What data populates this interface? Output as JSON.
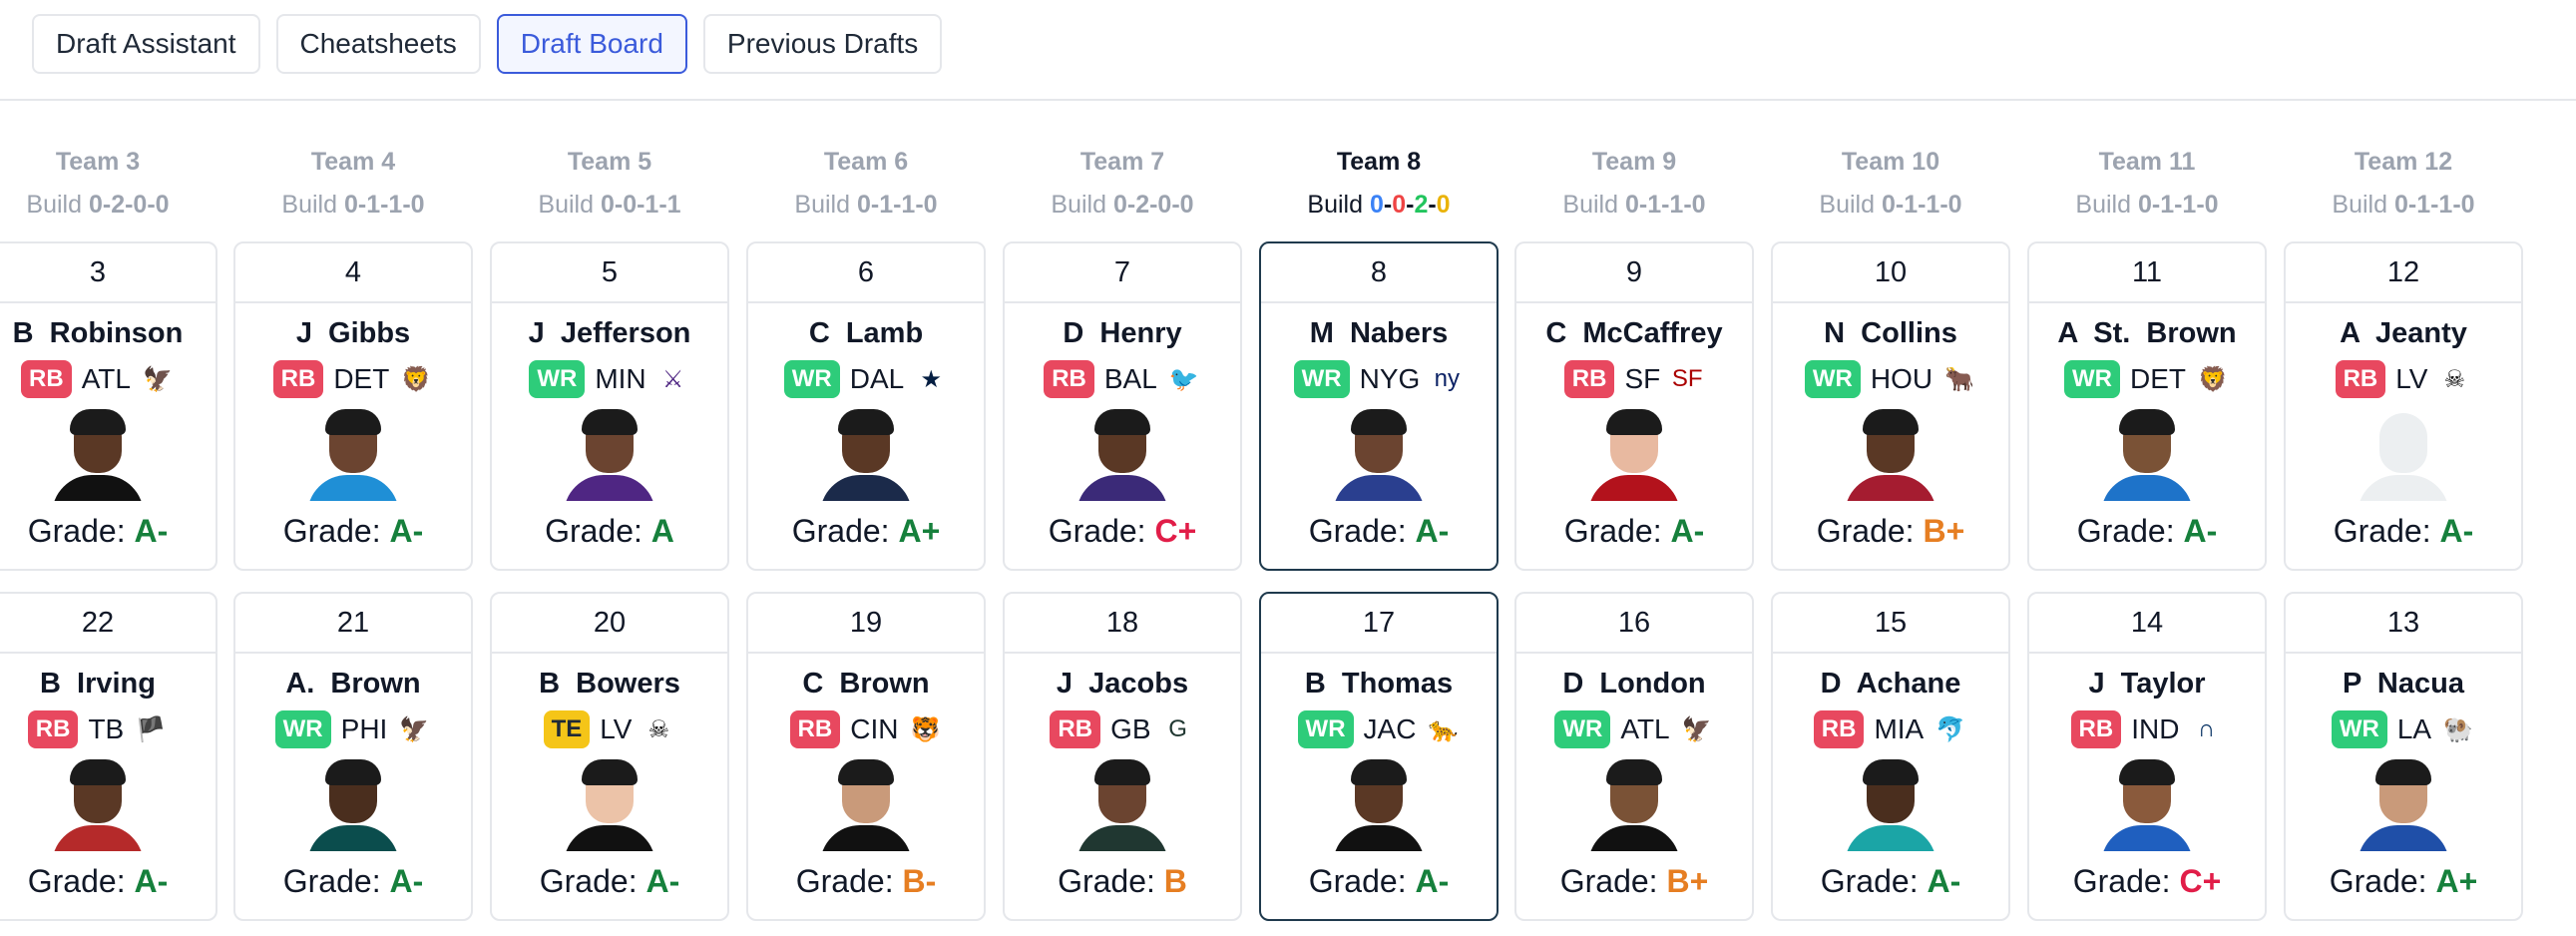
{
  "tabs": [
    {
      "label": "Draft Assistant",
      "active": false
    },
    {
      "label": "Cheatsheets",
      "active": false
    },
    {
      "label": "Draft Board",
      "active": true
    },
    {
      "label": "Previous Drafts",
      "active": false
    }
  ],
  "build_label": "Build",
  "grade_label": "Grade:",
  "teams": [
    {
      "name": "Team 3",
      "build": "0-2-0-0"
    },
    {
      "name": "Team 4",
      "build": "0-1-1-0"
    },
    {
      "name": "Team 5",
      "build": "0-0-1-1"
    },
    {
      "name": "Team 6",
      "build": "0-1-1-0"
    },
    {
      "name": "Team 7",
      "build": "0-2-0-0"
    },
    {
      "name": "Team 8",
      "build": "0-0-2-0",
      "current": true
    },
    {
      "name": "Team 9",
      "build": "0-1-1-0"
    },
    {
      "name": "Team 10",
      "build": "0-1-1-0"
    },
    {
      "name": "Team 11",
      "build": "0-1-1-0"
    },
    {
      "name": "Team 12",
      "build": "0-1-1-0"
    }
  ],
  "rounds": [
    [
      {
        "pick": "3",
        "first": "B",
        "last": "Robinson",
        "pos": "RB",
        "team": "ATL",
        "logo": "falcons-logo",
        "grade": "A-",
        "grade_color": "green",
        "skin": "#5a3825",
        "jersey": "#111111"
      },
      {
        "pick": "4",
        "first": "J",
        "last": "Gibbs",
        "pos": "RB",
        "team": "DET",
        "logo": "lions-logo",
        "grade": "A-",
        "grade_color": "green",
        "skin": "#6b4430",
        "jersey": "#1f8fd6"
      },
      {
        "pick": "5",
        "first": "J",
        "last": "Jefferson",
        "pos": "WR",
        "team": "MIN",
        "logo": "vikings-logo",
        "grade": "A",
        "grade_color": "green",
        "skin": "#6b4430",
        "jersey": "#4f2683"
      },
      {
        "pick": "6",
        "first": "C",
        "last": "Lamb",
        "pos": "WR",
        "team": "DAL",
        "logo": "cowboys-logo",
        "grade": "A+",
        "grade_color": "green",
        "skin": "#5a3825",
        "jersey": "#1b2a4a"
      },
      {
        "pick": "7",
        "first": "D",
        "last": "Henry",
        "pos": "RB",
        "team": "BAL",
        "logo": "ravens-logo",
        "grade": "C+",
        "grade_color": "red",
        "skin": "#5a3825",
        "jersey": "#3b2a78"
      },
      {
        "pick": "8",
        "first": "M",
        "last": "Nabers",
        "pos": "WR",
        "team": "NYG",
        "logo": "giants-logo",
        "grade": "A-",
        "grade_color": "green",
        "skin": "#6b4430",
        "jersey": "#2a3f8f",
        "current": true
      },
      {
        "pick": "9",
        "first": "C",
        "last": "McCaffrey",
        "pos": "RB",
        "team": "SF",
        "logo": "49ers-logo",
        "grade": "A-",
        "grade_color": "green",
        "skin": "#e8b9a0",
        "jersey": "#b3121c"
      },
      {
        "pick": "10",
        "first": "N",
        "last": "Collins",
        "pos": "WR",
        "team": "HOU",
        "logo": "texans-logo",
        "grade": "B+",
        "grade_color": "orange",
        "skin": "#5a3825",
        "jersey": "#a51c30"
      },
      {
        "pick": "11",
        "first": "A",
        "last": "St. Brown",
        "pos": "WR",
        "team": "DET",
        "logo": "lions-logo",
        "grade": "A-",
        "grade_color": "green",
        "skin": "#7a5236",
        "jersey": "#1e73c9"
      },
      {
        "pick": "12",
        "first": "A",
        "last": "Jeanty",
        "pos": "RB",
        "team": "LV",
        "logo": "raiders-logo",
        "grade": "A-",
        "grade_color": "green",
        "placeholder": true
      }
    ],
    [
      {
        "pick": "22",
        "first": "B",
        "last": "Irving",
        "pos": "RB",
        "team": "TB",
        "logo": "buccaneers-logo",
        "grade": "A-",
        "grade_color": "green",
        "skin": "#5a3825",
        "jersey": "#b52a2a"
      },
      {
        "pick": "21",
        "first": "A.",
        "last": "Brown",
        "pos": "WR",
        "team": "PHI",
        "logo": "eagles-logo",
        "grade": "A-",
        "grade_color": "green",
        "skin": "#4a2e1e",
        "jersey": "#0b4d4d"
      },
      {
        "pick": "20",
        "first": "B",
        "last": "Bowers",
        "pos": "TE",
        "team": "LV",
        "logo": "raiders-logo",
        "grade": "A-",
        "grade_color": "green",
        "skin": "#ecc3a8",
        "jersey": "#111111"
      },
      {
        "pick": "19",
        "first": "C",
        "last": "Brown",
        "pos": "RB",
        "team": "CIN",
        "logo": "bengals-logo",
        "grade": "B-",
        "grade_color": "orange",
        "skin": "#c99a7a",
        "jersey": "#111111"
      },
      {
        "pick": "18",
        "first": "J",
        "last": "Jacobs",
        "pos": "RB",
        "team": "GB",
        "logo": "packers-logo",
        "grade": "B",
        "grade_color": "orange",
        "skin": "#6b4430",
        "jersey": "#203731"
      },
      {
        "pick": "17",
        "first": "B",
        "last": "Thomas",
        "pos": "WR",
        "team": "JAC",
        "logo": "jaguars-logo",
        "grade": "A-",
        "grade_color": "green",
        "skin": "#5a3825",
        "jersey": "#111111",
        "current": true
      },
      {
        "pick": "16",
        "first": "D",
        "last": "London",
        "pos": "WR",
        "team": "ATL",
        "logo": "falcons-logo",
        "grade": "B+",
        "grade_color": "orange",
        "skin": "#7a5236",
        "jersey": "#111111"
      },
      {
        "pick": "15",
        "first": "D",
        "last": "Achane",
        "pos": "RB",
        "team": "MIA",
        "logo": "dolphins-logo",
        "grade": "A-",
        "grade_color": "green",
        "skin": "#4a2e1e",
        "jersey": "#1ba5a6"
      },
      {
        "pick": "14",
        "first": "J",
        "last": "Taylor",
        "pos": "RB",
        "team": "IND",
        "logo": "colts-logo",
        "grade": "C+",
        "grade_color": "red",
        "skin": "#8a5a3c",
        "jersey": "#1f5fbf"
      },
      {
        "pick": "13",
        "first": "P",
        "last": "Nacua",
        "pos": "WR",
        "team": "LA",
        "logo": "rams-logo",
        "grade": "A+",
        "grade_color": "green",
        "skin": "#c99a7a",
        "jersey": "#1f4fa8"
      }
    ]
  ],
  "colors": {
    "rb": "#e8485f",
    "wr": "#2ecc7a",
    "te": "#f5c518",
    "grade_green": "#16803c",
    "grade_red": "#e11d48",
    "grade_orange": "#e67e22",
    "active_tab": "#3b5bdb",
    "current_border": "#1f3a4d"
  }
}
